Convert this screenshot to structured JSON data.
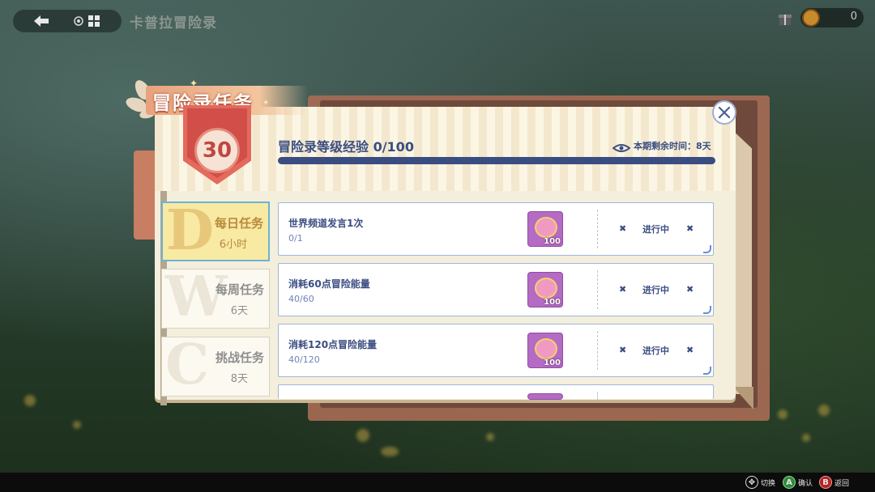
{
  "app": {
    "title": "卡普拉冒险录",
    "coins": "0"
  },
  "panel": {
    "title": "冒险录任务",
    "level": "30",
    "exp_label": "冒险录等级经验 0/100",
    "exp_progress": 0,
    "time_label": "本期剩余时间：8天"
  },
  "tabs": [
    {
      "letter": "D",
      "name": "每日任务",
      "sub": "6小时",
      "active": true
    },
    {
      "letter": "W",
      "name": "每周任务",
      "sub": "6天",
      "active": false
    },
    {
      "letter": "C",
      "name": "挑战任务",
      "sub": "8天",
      "active": false
    }
  ],
  "tasks": [
    {
      "title": "世界频道发言1次",
      "progress": "0/1",
      "reward_amount": "100",
      "status": "进行中"
    },
    {
      "title": "消耗60点冒险能量",
      "progress": "40/60",
      "reward_amount": "100",
      "status": "进行中"
    },
    {
      "title": "消耗120点冒险能量",
      "progress": "40/120",
      "reward_amount": "100",
      "status": "进行中"
    }
  ],
  "footer": {
    "switch": "切换",
    "confirm": "确认",
    "back": "返回",
    "confirm_key": "A",
    "back_key": "B"
  },
  "colors": {
    "accent": "#3a4d82",
    "active_tab": "#f8e9a3",
    "reward_bg": "#b56ac4"
  }
}
